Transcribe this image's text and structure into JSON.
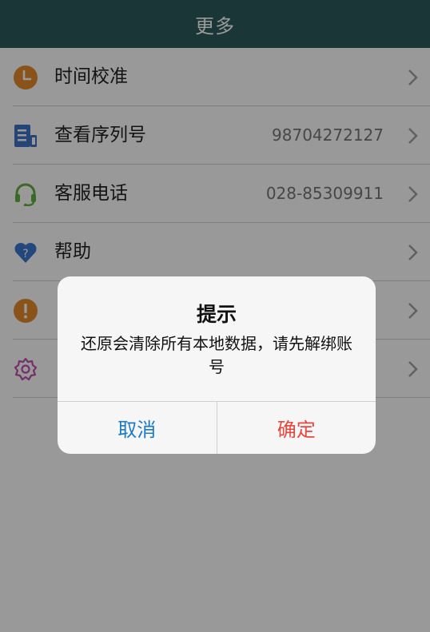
{
  "header": {
    "title": "更多"
  },
  "list": [
    {
      "label": "时间校准",
      "value": "",
      "icon": "clock-icon",
      "icon_color": "#e58a2b"
    },
    {
      "label": "查看序列号",
      "value": "98704272127",
      "icon": "document-icon",
      "icon_color": "#3f74c6"
    },
    {
      "label": "客服电话",
      "value": "028-85309911",
      "icon": "headset-icon",
      "icon_color": "#62b13c"
    },
    {
      "label": "帮助",
      "value": "",
      "icon": "heart-question-icon",
      "icon_color": "#3b78d0"
    },
    {
      "label": "",
      "value": "",
      "icon": "exclamation-icon",
      "icon_color": "#e58a2b"
    },
    {
      "label": "",
      "value": "",
      "icon": "gear-icon",
      "icon_color": "#c44fb0"
    }
  ],
  "dialog": {
    "title": "提示",
    "message": "还原会清除所有本地数据，请先解绑账号",
    "cancel_label": "取消",
    "confirm_label": "确定"
  },
  "colors": {
    "header_bg": "#2e5a5c",
    "cancel": "#1a7ac8",
    "confirm": "#e24a3f"
  }
}
